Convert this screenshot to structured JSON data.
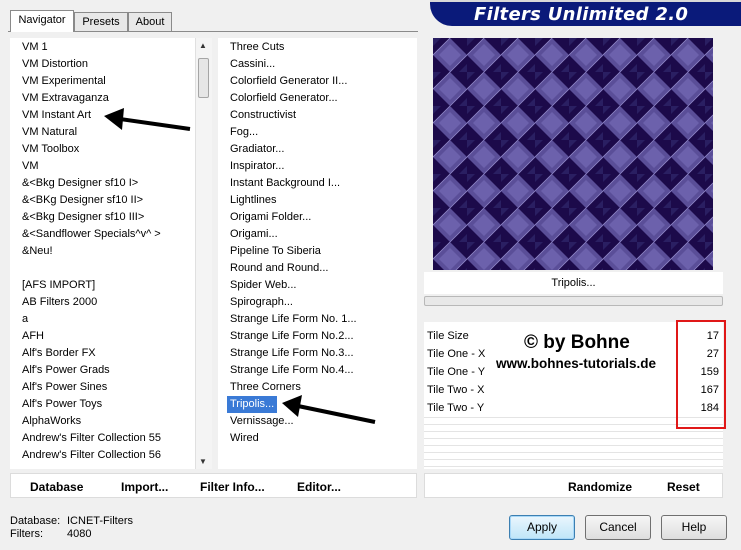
{
  "tabs": [
    "Navigator",
    "Presets",
    "About"
  ],
  "banner_title": "Filters Unlimited 2.0",
  "categories": [
    "VM 1",
    "VM Distortion",
    "VM Experimental",
    "VM Extravaganza",
    "VM Instant Art",
    "VM Natural",
    "VM Toolbox",
    "VM",
    "&<Bkg Designer sf10 I>",
    "&<BKg Designer sf10 II>",
    "&<Bkg Designer sf10 III>",
    "&<Sandflower Specials^v^ >",
    "&Neu!",
    "",
    "[AFS IMPORT]",
    "AB Filters 2000",
    "a",
    "AFH",
    "Alf's Border FX",
    "Alf's Power Grads",
    "Alf's Power Sines",
    "Alf's Power Toys",
    "AlphaWorks",
    "Andrew's Filter Collection 55",
    "Andrew's Filter Collection 56"
  ],
  "filters": [
    "Three Cuts",
    "Cassini...",
    "Colorfield Generator II...",
    "Colorfield Generator...",
    "Constructivist",
    "Fog...",
    "Gradiator...",
    "Inspirator...",
    "Instant Background I...",
    "Lightlines",
    "Origami Folder...",
    "Origami...",
    "Pipeline To Siberia",
    "Round and Round...",
    "Spider Web...",
    "Spirograph...",
    "Strange Life Form No. 1...",
    "Strange Life Form No.2...",
    "Strange Life Form No.3...",
    "Strange Life Form No.4...",
    "Three Corners",
    "Tripolis...",
    "Vernissage...",
    "Wired"
  ],
  "selected_filter": "Tripolis...",
  "filter_title": "Tripolis...",
  "params": [
    {
      "name": "Tile Size",
      "value": "17"
    },
    {
      "name": "Tile One - X",
      "value": "27"
    },
    {
      "name": "Tile One - Y",
      "value": "159"
    },
    {
      "name": "Tile Two - X",
      "value": "167"
    },
    {
      "name": "Tile Two - Y",
      "value": "184"
    }
  ],
  "watermark": {
    "line1": "© by Bohne",
    "line2": "www.bohnes-tutorials.de"
  },
  "left_buttons": {
    "database": "Database",
    "import": "Import...",
    "filter_info": "Filter Info...",
    "editor": "Editor..."
  },
  "right_buttons": {
    "randomize": "Randomize",
    "reset": "Reset"
  },
  "status": {
    "database_label": "Database:",
    "database_value": "ICNET-Filters",
    "filters_label": "Filters:",
    "filters_value": "4080"
  },
  "dialog_buttons": {
    "apply": "Apply",
    "cancel": "Cancel",
    "help": "Help"
  },
  "colors": {
    "banner": "#0a1a7a",
    "selection": "#3a7ad6",
    "highlight_box": "#e01818",
    "preview_dark": "#1c0a4a",
    "preview_light": "#6a5fa8"
  }
}
